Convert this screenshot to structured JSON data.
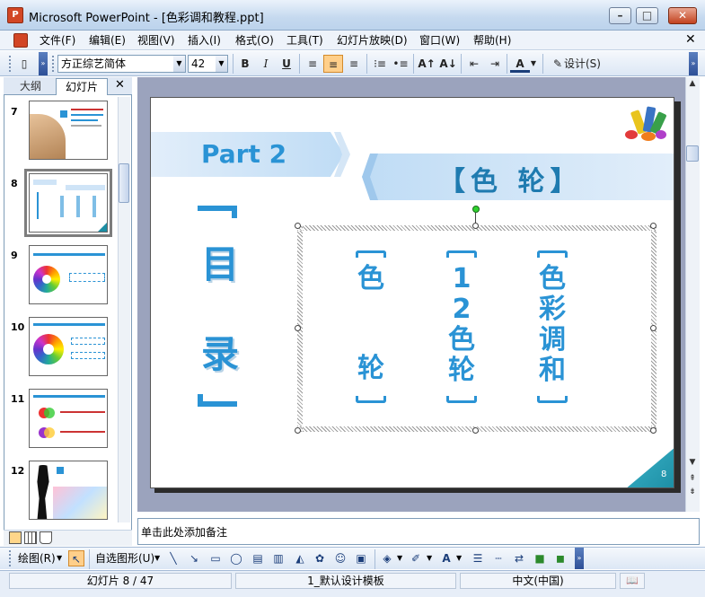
{
  "window": {
    "title": "Microsoft PowerPoint - [色彩调和教程.ppt]",
    "app_icon": "P"
  },
  "menu": [
    "文件(F)",
    "编辑(E)",
    "视图(V)",
    "插入(I)",
    "格式(O)",
    "工具(T)",
    "幻灯片放映(D)",
    "窗口(W)",
    "帮助(H)"
  ],
  "toolbar": {
    "font": "方正综艺简体",
    "size": "42",
    "bold": "B",
    "italic": "I",
    "underline": "U",
    "design": "设计(S)",
    "font_color": "A"
  },
  "panel": {
    "tab_outline": "大纲",
    "tab_slides": "幻灯片",
    "slide_numbers": [
      "7",
      "8",
      "9",
      "10",
      "11",
      "12"
    ],
    "selected": "8"
  },
  "slide": {
    "part": "Part 2",
    "title": "【色  轮】",
    "heading_chars": [
      "目",
      "录"
    ],
    "columns": [
      {
        "chars": [
          "色",
          "",
          "轮"
        ]
      },
      {
        "chars": [
          "1",
          "2",
          "色",
          "轮"
        ]
      },
      {
        "chars": [
          "色",
          "彩",
          "调",
          "和"
        ]
      }
    ],
    "number": "8"
  },
  "notes": {
    "placeholder": "单击此处添加备注"
  },
  "drawbar": {
    "draw": "绘图(R)",
    "autoshapes": "自选图形(U)"
  },
  "status": {
    "slide": "幻灯片 8 / 47",
    "template": "1_默认设计模板",
    "language": "中文(中国)"
  },
  "colors": {
    "accent": "#2a93d5",
    "titlebar": "#c5d9ef",
    "corner": "#1c8ea4"
  }
}
